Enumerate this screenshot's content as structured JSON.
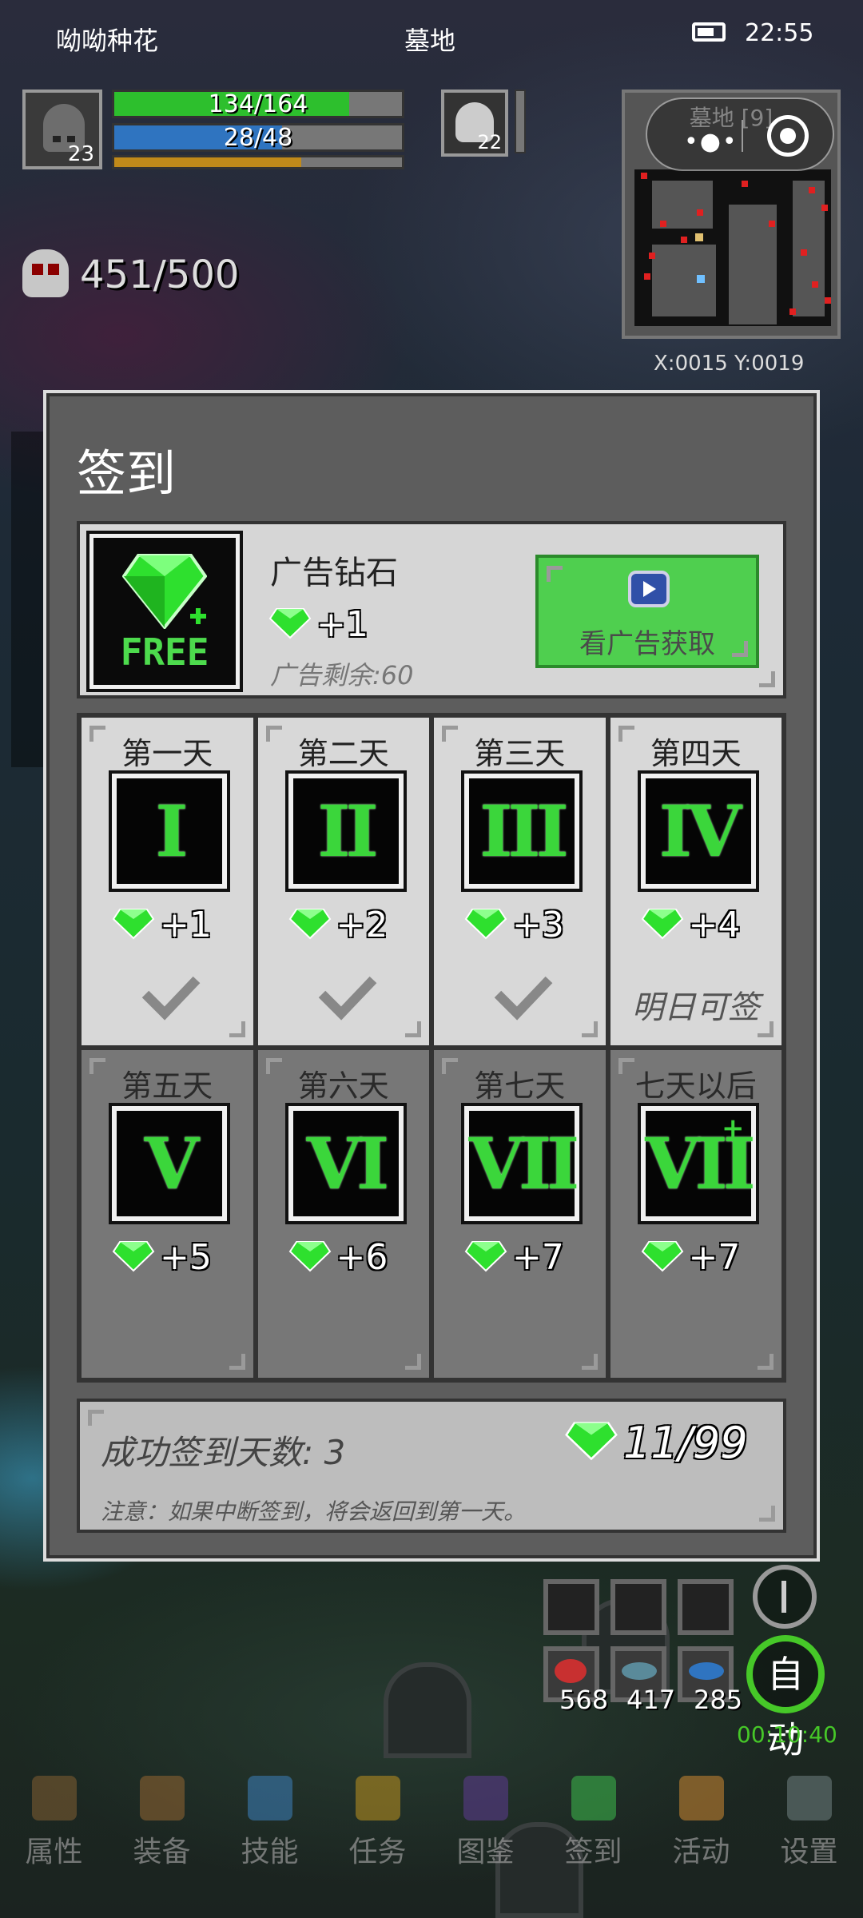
{
  "status_bar": {
    "left_text": "呦呦种花",
    "center_text": "墓地",
    "time": "22:55"
  },
  "player": {
    "level": "23",
    "hp_text": "134/164",
    "hp_fraction": 0.817,
    "mp_text": "28/48",
    "mp_fraction": 0.583,
    "xp_fraction": 0.65
  },
  "pet": {
    "level": "22"
  },
  "kills": {
    "text": "451/500"
  },
  "minimap": {
    "title": "墓地 [9]",
    "coords": "X:0015  Y:0019"
  },
  "modal": {
    "title": "签到",
    "ad": {
      "icon_text": "FREE",
      "name": "广告钻石",
      "reward": "+1",
      "remaining": "广告剩余:60",
      "button_label": "看广告获取"
    },
    "days": [
      {
        "title": "第一天",
        "numeral": "I",
        "reward": "+1",
        "state": "claimed"
      },
      {
        "title": "第二天",
        "numeral": "II",
        "reward": "+2",
        "state": "claimed"
      },
      {
        "title": "第三天",
        "numeral": "III",
        "reward": "+3",
        "state": "claimed"
      },
      {
        "title": "第四天",
        "numeral": "IV",
        "reward": "+4",
        "state": "next",
        "status_text": "明日可签"
      },
      {
        "title": "第五天",
        "numeral": "V",
        "reward": "+5",
        "state": "locked"
      },
      {
        "title": "第六天",
        "numeral": "VI",
        "reward": "+6",
        "state": "locked"
      },
      {
        "title": "第七天",
        "numeral": "VII",
        "reward": "+7",
        "state": "locked"
      },
      {
        "title": "七天以后",
        "numeral": "VII",
        "reward": "+7",
        "state": "locked"
      }
    ],
    "footer": {
      "success_label": "成功签到天数: 3",
      "total": "11/99",
      "notice": "注意：如果中断签到，将会返回到第一天。"
    }
  },
  "quick_items": {
    "counts": [
      "568",
      "417",
      "285"
    ]
  },
  "auto": {
    "label": "自动",
    "timer": "00:10:40"
  },
  "nav": [
    {
      "label": "属性",
      "icon": "helmet-icon",
      "color": "#7a5a30"
    },
    {
      "label": "装备",
      "icon": "bag-icon",
      "color": "#8a6030"
    },
    {
      "label": "技能",
      "icon": "skill-orb-icon",
      "color": "#3a7ab0"
    },
    {
      "label": "任务",
      "icon": "question-icon",
      "color": "#b08a20"
    },
    {
      "label": "图鉴",
      "icon": "book-icon",
      "color": "#5a3a8a"
    },
    {
      "label": "签到",
      "icon": "gem-icon",
      "color": "#3ab04a"
    },
    {
      "label": "活动",
      "icon": "face-icon",
      "color": "#c08030"
    },
    {
      "label": "设置",
      "icon": "gear-icon",
      "color": "#6a7a7a"
    }
  ],
  "colors": {
    "hp": "#2dbf2d",
    "mp": "#2f74c0",
    "xp": "#c08a1a",
    "accent_green": "#4fcf4f"
  }
}
